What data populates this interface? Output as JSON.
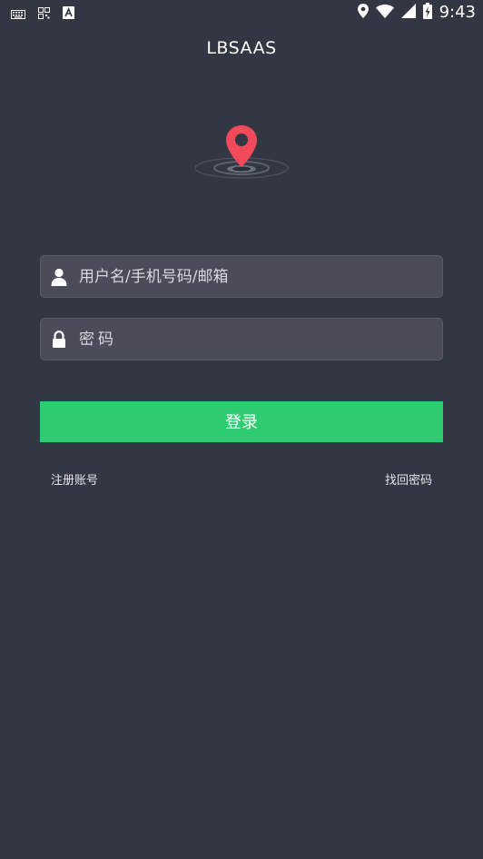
{
  "status_bar": {
    "time": "9:43",
    "left_icons": [
      "keyboard-icon",
      "qr-grid-icon",
      "a-box-icon"
    ],
    "right_icons": [
      "location-icon",
      "wifi-icon",
      "signal-icon",
      "battery-charging-icon"
    ]
  },
  "app": {
    "title": "LBSAAS"
  },
  "logo": {
    "icon": "map-pin-icon",
    "pin_color": "#f24a5a"
  },
  "login_form": {
    "username": {
      "icon": "user-icon",
      "value": "",
      "placeholder": "用户名/手机号码/邮箱"
    },
    "password": {
      "icon": "lock-icon",
      "value": "",
      "placeholder": "密码"
    },
    "submit_label": "登录",
    "register_label": "注册账号",
    "forgot_label": "找回密码"
  },
  "colors": {
    "background": "#333743",
    "field_background": "#4a4c59",
    "button": "#2ecc71"
  }
}
